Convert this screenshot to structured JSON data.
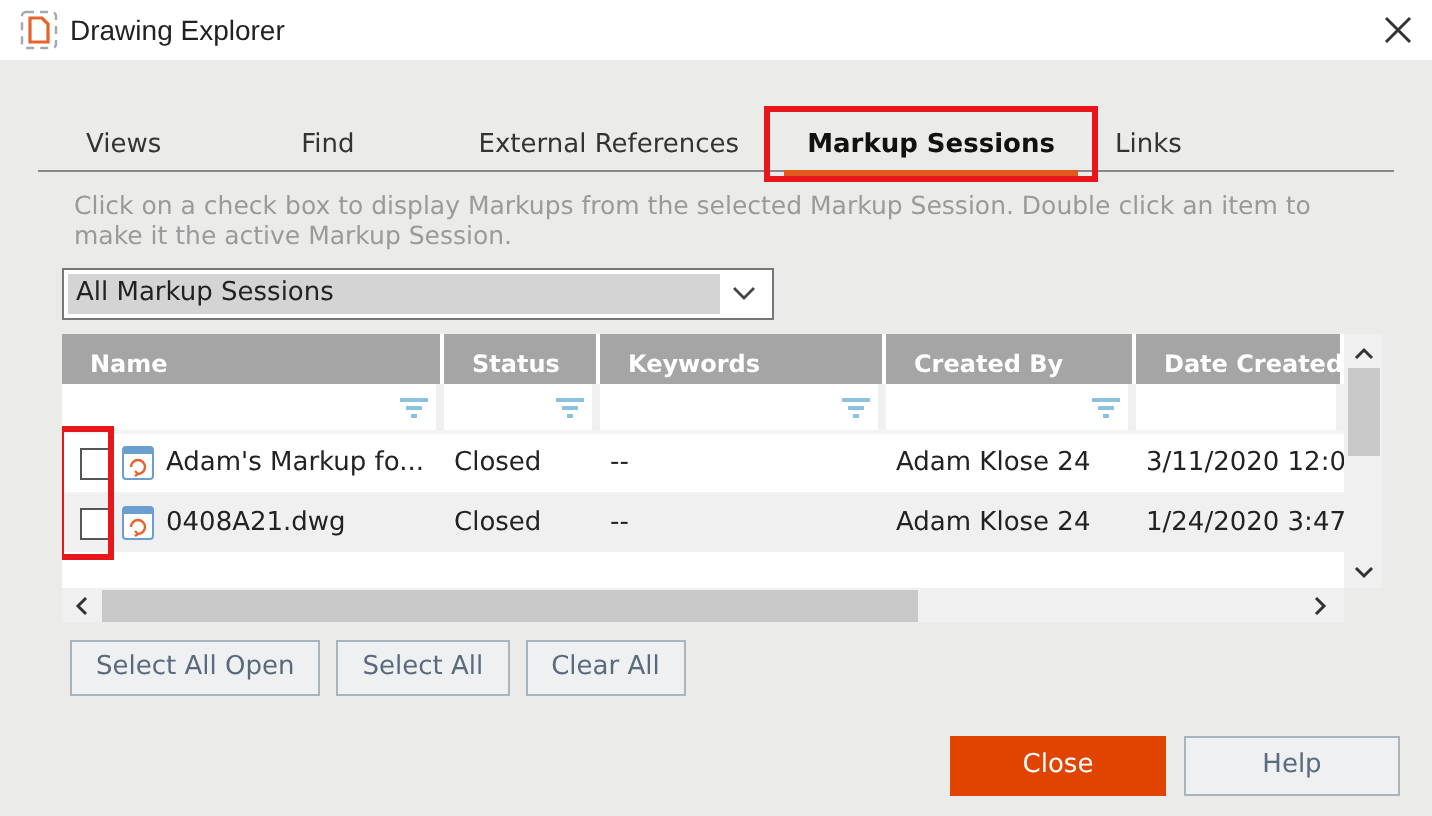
{
  "window": {
    "title": "Drawing Explorer"
  },
  "tabs": [
    {
      "label": "Views",
      "selected": false,
      "highlighted": false
    },
    {
      "label": "Find",
      "selected": false,
      "highlighted": false
    },
    {
      "label": "External References",
      "selected": false,
      "highlighted": false
    },
    {
      "label": "Markup Sessions",
      "selected": true,
      "highlighted": true
    },
    {
      "label": "Links",
      "selected": false,
      "highlighted": false
    }
  ],
  "hint": "Click on a check box to display Markups from the selected Markup Session. Double click an item to make it the active Markup Session.",
  "filter_dropdown": {
    "value": "All Markup Sessions"
  },
  "table": {
    "columns": [
      "Name",
      "Status",
      "Keywords",
      "Created By",
      "Date Created"
    ],
    "checkboxes_highlighted": true,
    "rows": [
      {
        "checked": false,
        "cells": [
          "Adam's Markup fo...",
          "Closed",
          "--",
          "Adam Klose 24",
          "3/11/2020 12:0"
        ]
      },
      {
        "checked": false,
        "cells": [
          "0408A21.dwg",
          "Closed",
          "--",
          "Adam Klose 24",
          "1/24/2020 3:47"
        ]
      }
    ]
  },
  "selection_buttons": [
    "Select All Open",
    "Select All",
    "Clear All"
  ],
  "dialog_buttons": [
    {
      "label": "Close",
      "primary": true
    },
    {
      "label": "Help",
      "primary": false
    }
  ]
}
